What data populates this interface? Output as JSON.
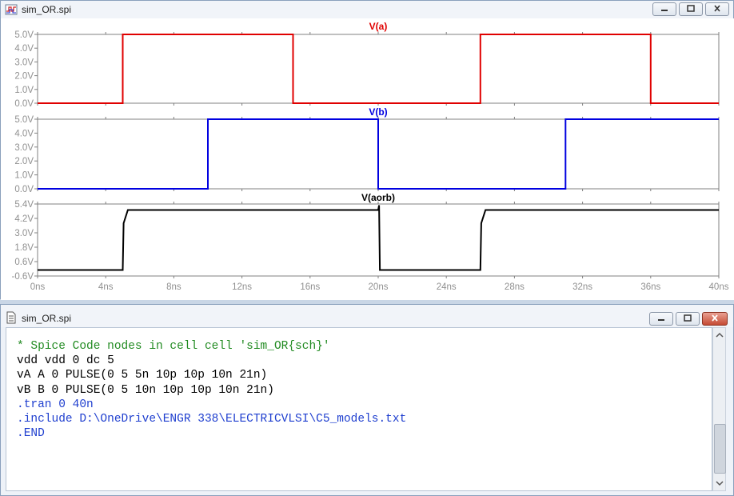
{
  "plot_window": {
    "title": "sim_OR.spi",
    "icon": "waveform-icon"
  },
  "code_window": {
    "title": "sim_OR.spi",
    "icon": "document-icon",
    "lines": [
      "* Spice Code nodes in cell cell 'sim_OR{sch}'",
      "vdd vdd 0 dc 5",
      "vA A 0 PULSE(0 5 5n 10p 10p 10n 21n)",
      "vB B 0 PULSE(0 5 10n 10p 10p 10n 21n)",
      ".tran 0 40n",
      ".include D:\\OneDrive\\ENGR 338\\ELECTRICVLSI\\C5_models.txt",
      ".END"
    ],
    "line_colors": [
      "comment",
      "black",
      "black",
      "black",
      "blue",
      "blue",
      "blue"
    ]
  },
  "controls": [
    "minimize-icon",
    "maximize-icon",
    "close-icon"
  ],
  "chart_data": [
    {
      "type": "line",
      "title": "V(a)",
      "color": "#e00000",
      "x": [
        0,
        5,
        5,
        15,
        15,
        26,
        26,
        36,
        36,
        40
      ],
      "y": [
        0,
        0,
        5,
        5,
        0,
        0,
        5,
        5,
        0,
        0
      ],
      "yticks": [
        "5.0V",
        "4.0V",
        "3.0V",
        "2.0V",
        "1.0V",
        "0.0V"
      ],
      "ytick_values": [
        5,
        4,
        3,
        2,
        1,
        0
      ],
      "ylim": [
        0,
        5
      ],
      "xlim": [
        0,
        40
      ]
    },
    {
      "type": "line",
      "title": "V(b)",
      "color": "#0000e0",
      "x": [
        0,
        10,
        10,
        20,
        20,
        31,
        31,
        40
      ],
      "y": [
        0,
        0,
        5,
        5,
        0,
        0,
        5,
        5
      ],
      "yticks": [
        "5.0V",
        "4.0V",
        "3.0V",
        "2.0V",
        "1.0V",
        "0.0V"
      ],
      "ytick_values": [
        5,
        4,
        3,
        2,
        1,
        0
      ],
      "ylim": [
        0,
        5
      ],
      "xlim": [
        0,
        40
      ]
    },
    {
      "type": "line",
      "title": "V(aorb)",
      "color": "#000000",
      "x": [
        0,
        5,
        5.05,
        5.3,
        10,
        15,
        20,
        20.05,
        20.1,
        26,
        26.05,
        26.3,
        31,
        36,
        40
      ],
      "y": [
        -0.1,
        -0.1,
        3.8,
        4.9,
        4.9,
        4.9,
        4.9,
        5.3,
        -0.1,
        -0.1,
        3.8,
        4.9,
        4.9,
        4.9,
        4.9
      ],
      "yticks": [
        "5.4V",
        "4.2V",
        "3.0V",
        "1.8V",
        "0.6V",
        "-0.6V"
      ],
      "ytick_values": [
        5.4,
        4.2,
        3.0,
        1.8,
        0.6,
        -0.6
      ],
      "ylim": [
        -0.6,
        5.4
      ],
      "xlim": [
        0,
        40
      ]
    }
  ],
  "xaxis": {
    "ticks": [
      "0ns",
      "4ns",
      "8ns",
      "12ns",
      "16ns",
      "20ns",
      "24ns",
      "28ns",
      "32ns",
      "36ns",
      "40ns"
    ],
    "tick_values": [
      0,
      4,
      8,
      12,
      16,
      20,
      24,
      28,
      32,
      36,
      40
    ]
  }
}
